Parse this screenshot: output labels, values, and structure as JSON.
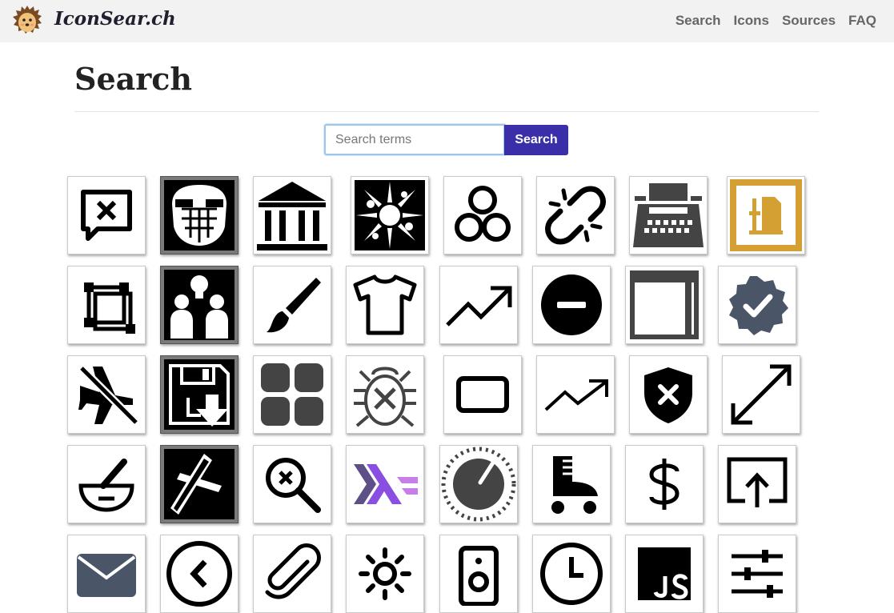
{
  "navbar": {
    "brand": "IconSear.ch",
    "brand_icon": "hedgehog-logo-icon",
    "links": [
      "Search",
      "Icons",
      "Sources",
      "FAQ"
    ]
  },
  "main": {
    "title": "Search",
    "search": {
      "placeholder": "Search terms",
      "value": "",
      "button_label": "Search"
    }
  },
  "icon_results": [
    [
      "chat-close-icon",
      "helmet-icon",
      "bank-icon",
      "sunburst-icon",
      "three-circles-icon",
      "broken-link-icon",
      "typewriter-icon",
      "file-vise-icon"
    ],
    [
      "crop-frame-icon",
      "idea-people-icon",
      "paintbrush-icon",
      "t-shirt-icon",
      "trending-up-icon",
      "minus-circle-icon",
      "window-icon",
      "verified-badge-icon"
    ],
    [
      "airplane-off-icon",
      "floppy-download-icon",
      "grid-squares-icon",
      "bug-off-icon",
      "rectangle-icon",
      "trending-up-thin-icon",
      "shield-x-icon",
      "arrows-expand-icon"
    ],
    [
      "mortar-pestle-icon",
      "cross-icon",
      "zoom-cancel-icon",
      "haskell-icon",
      "dial-knob-icon",
      "roller-skate-icon",
      "dollar-icon",
      "screen-share-icon"
    ],
    [
      "envelope-icon",
      "chevron-left-circle-icon",
      "paperclip-icon",
      "brightness-icon",
      "speaker-icon",
      "clock-icon",
      "javascript-icon",
      "sliders-icon"
    ]
  ],
  "colors": {
    "navbar_bg": "#f2f2f2",
    "search_button": "#3a2fa8",
    "icon_gold": "#d4a033",
    "icon_slate": "#4a5568",
    "haskell_purple": "#8a4fe0"
  }
}
